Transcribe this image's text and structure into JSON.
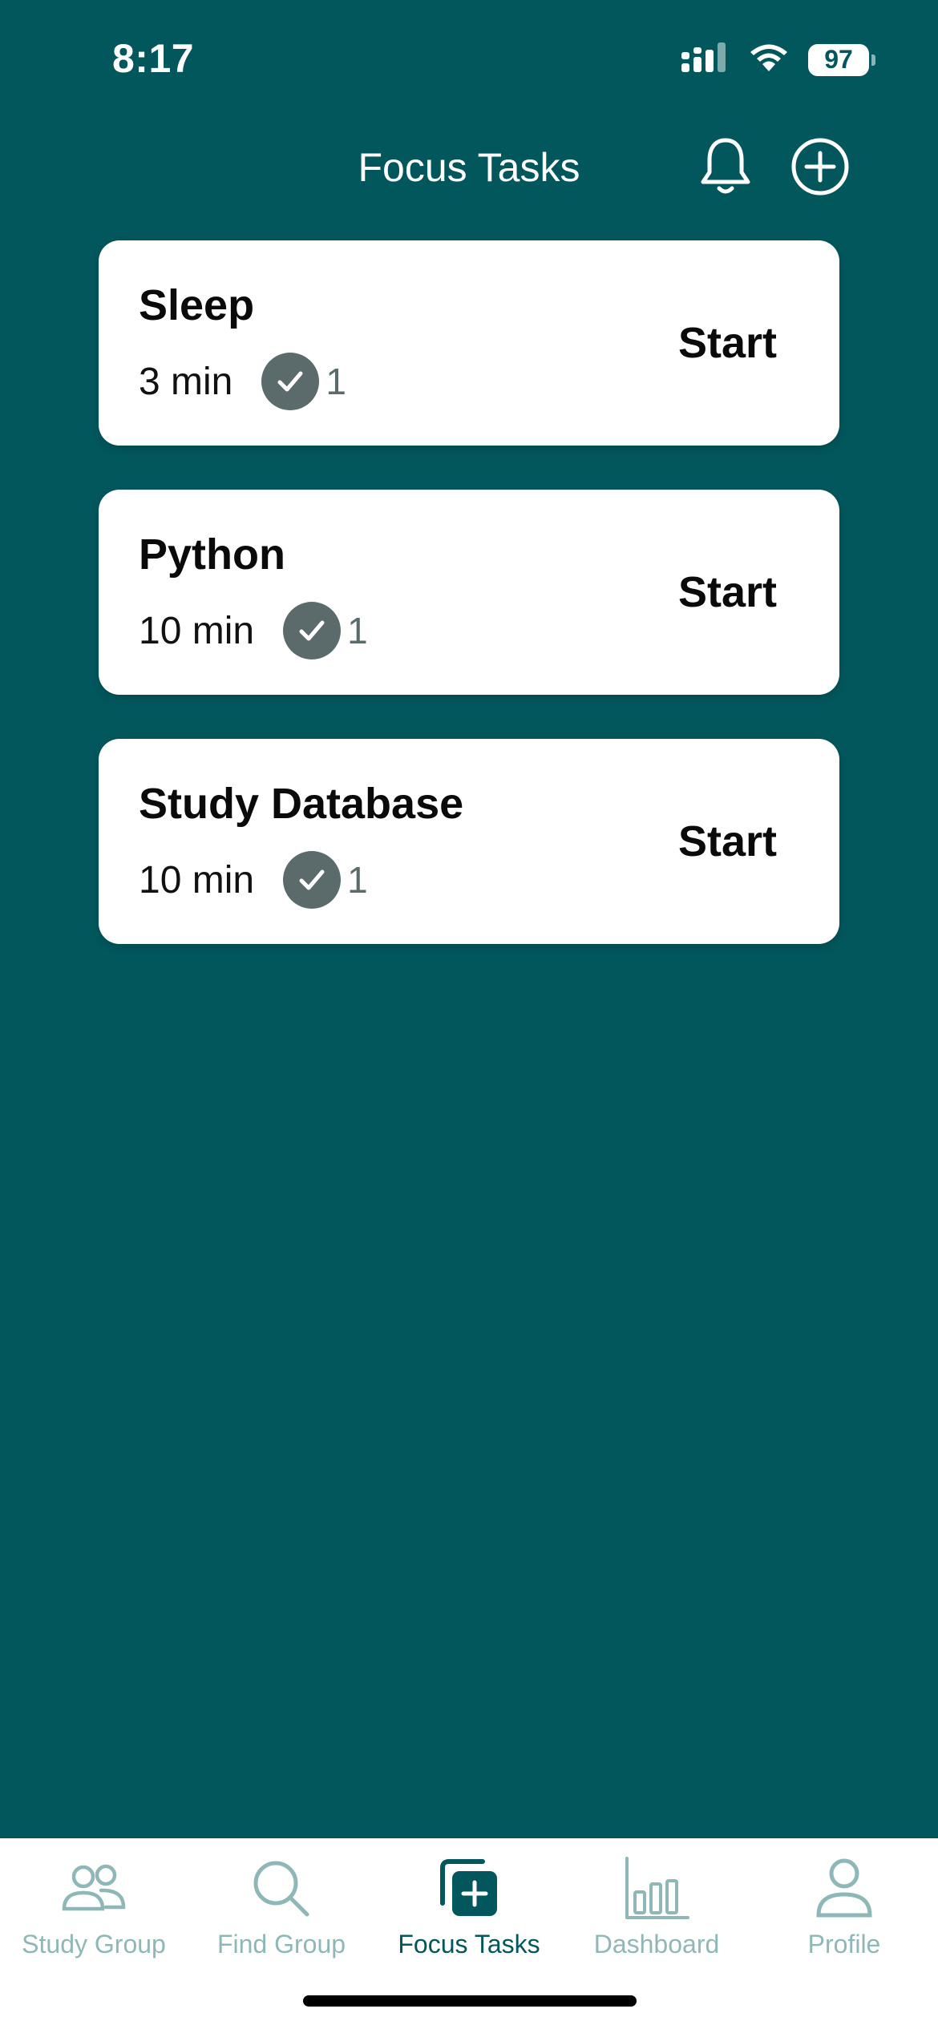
{
  "status_bar": {
    "time": "8:17",
    "battery": "97"
  },
  "header": {
    "title": "Focus Tasks"
  },
  "tasks": [
    {
      "title": "Sleep",
      "duration": "3 min",
      "completed_count": "1",
      "action": "Start"
    },
    {
      "title": "Python",
      "duration": "10 min",
      "completed_count": "1",
      "action": "Start"
    },
    {
      "title": "Study Database",
      "duration": "10 min",
      "completed_count": "1",
      "action": "Start"
    }
  ],
  "tab_bar": {
    "items": [
      {
        "label": "Study Group",
        "icon": "people-icon",
        "active": false
      },
      {
        "label": "Find Group",
        "icon": "search-icon",
        "active": false
      },
      {
        "label": "Focus Tasks",
        "icon": "add-task-icon",
        "active": true
      },
      {
        "label": "Dashboard",
        "icon": "bar-chart-icon",
        "active": false
      },
      {
        "label": "Profile",
        "icon": "person-icon",
        "active": false
      }
    ]
  },
  "colors": {
    "background": "#02575c",
    "card": "#ffffff",
    "check_badge": "#5b6a6b",
    "tab_inactive": "#8fb7b7",
    "tab_active": "#02575c"
  }
}
